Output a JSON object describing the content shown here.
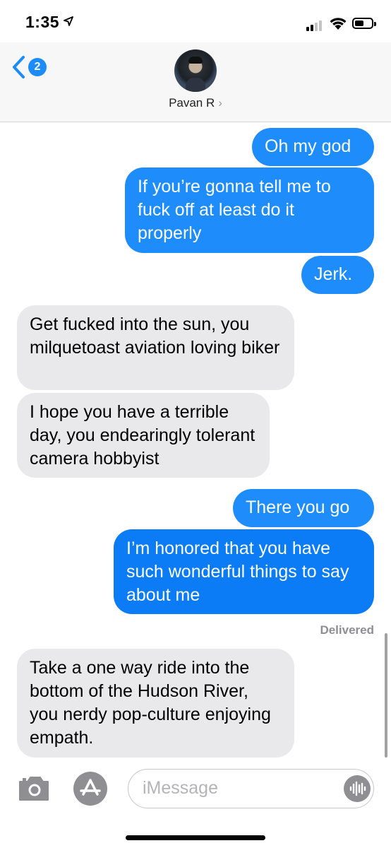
{
  "status_bar": {
    "time": "1:35",
    "signal_bars": 4,
    "signal_active": 2,
    "battery_level": 0.55
  },
  "header": {
    "back_badge": "2",
    "contact_name": "Pavan R",
    "chevron": "›"
  },
  "messages": [
    {
      "type": "sent",
      "text": "Oh my god"
    },
    {
      "type": "sent",
      "text": "If you’re gonna tell me to fuck off at least do it properly"
    },
    {
      "type": "sent",
      "text": "Jerk."
    },
    {
      "type": "received",
      "text": "Get fucked into the sun, you milquetoast aviation loving biker"
    },
    {
      "type": "received",
      "text": "I hope you have a terrible day, you endearingly tolerant camera hobbyist"
    },
    {
      "type": "sent",
      "text": "There you go"
    },
    {
      "type": "sent",
      "text": "I’m honored that you have such wonderful things to say about me"
    },
    {
      "type": "received",
      "text": "Take a one way ride into the bottom of the Hudson River, you nerdy pop-culture enjoying empath."
    }
  ],
  "delivered_label": "Delivered",
  "composer": {
    "placeholder": "iMessage"
  },
  "icons": {
    "location": "location-arrow-icon",
    "back": "chevron-left-icon",
    "camera": "camera-icon",
    "apps": "app-store-icon",
    "audio": "audio-waveform-icon"
  },
  "colors": {
    "sent_bubble": "#1e8cfa",
    "received_bubble": "#e9e9eb",
    "accent": "#1b8cf8"
  }
}
